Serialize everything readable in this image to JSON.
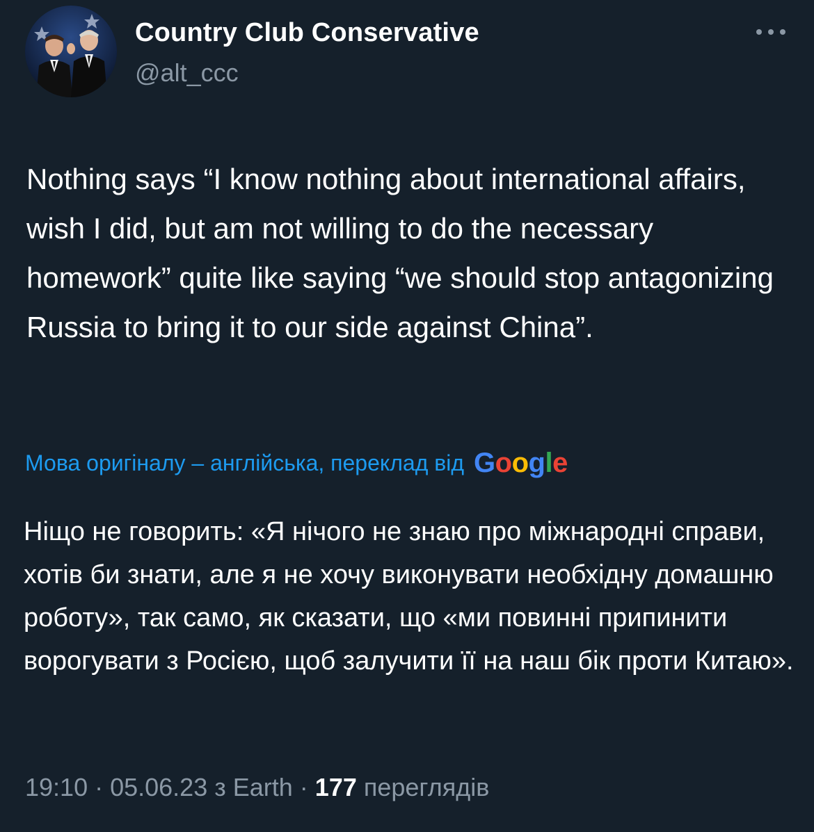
{
  "author": {
    "display_name": "Country Club Conservative",
    "handle": "@alt_ccc",
    "avatar_icon": "avatar-photo"
  },
  "more_icon": "more-options-icon",
  "tweet": {
    "text": "Nothing says “I know nothing about international affairs, wish I did, but am not willing to do the necessary homework” quite like saying “we should stop antagonizing Russia to bring it to our side against China”."
  },
  "translation": {
    "label": "Мова оригіналу – англійська, переклад від",
    "provider": "Google",
    "provider_colors": [
      "#4285F4",
      "#EA4335",
      "#FBBC05",
      "#4285F4",
      "#34A853",
      "#EA4335"
    ],
    "text": "Ніщо не говорить: «Я нічого не знаю про міжнародні справи, хотів би знати, але я не хочу виконувати необхідну домашню роботу», так само, як сказати, що «ми повинні припинити ворогувати з Росією, щоб залучити її на наш бік проти Китаю»."
  },
  "meta": {
    "time": "19:10",
    "sep1": " · ",
    "date": "05.06.23",
    "source_prefix": " з ",
    "source": "Earth",
    "sep2": " · ",
    "views_count": "177",
    "views_label": " переглядів"
  },
  "colors": {
    "background": "#15202b",
    "text": "#ffffff",
    "muted": "#8b98a5",
    "link": "#1d9bf0"
  }
}
